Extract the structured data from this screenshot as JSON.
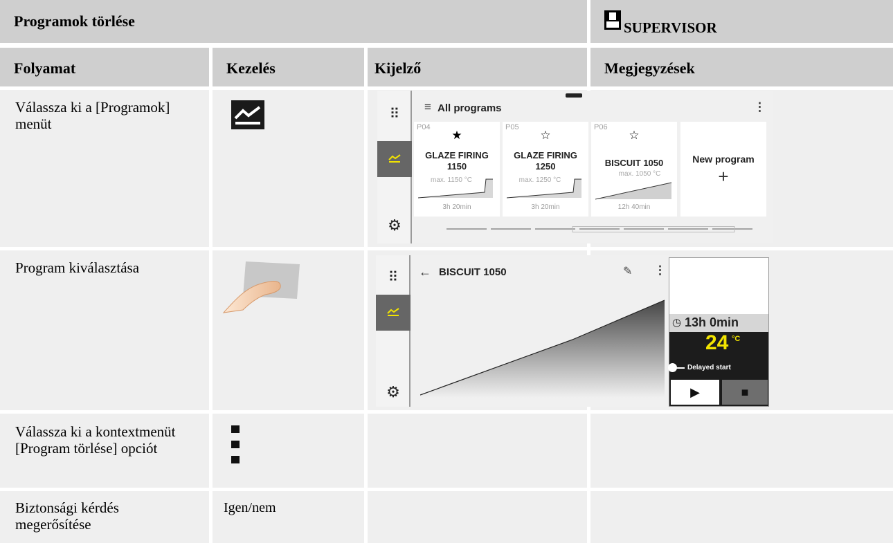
{
  "header": {
    "title": "Programok törlése",
    "role": "SUPERVISOR"
  },
  "columns": [
    "Folyamat",
    "Kezelés",
    "Kijelző",
    "Megjegyzések"
  ],
  "rows": [
    {
      "process": "Válassza ki a [Programok] menüt",
      "operation": ""
    },
    {
      "process": "Program kiválasztása",
      "operation": ""
    },
    {
      "process": "Válassza ki a kontextmenüt [Program törlése] opciót",
      "operation": ""
    },
    {
      "process": "Biztonsági kérdés megerősítése",
      "operation": "Igen/nem"
    }
  ],
  "screen1": {
    "title": "All programs",
    "list_icon": "≡",
    "more_icon": "⋮",
    "programs": [
      {
        "no": "P04",
        "star": "★",
        "name": "GLAZE FIRING 1150",
        "max": "max. 1150 °C",
        "time": "3h 20min"
      },
      {
        "no": "P05",
        "star": "☆",
        "name": "GLAZE FIRING 1250",
        "max": "max. 1250 °C",
        "time": "3h 20min"
      },
      {
        "no": "P06",
        "star": "☆",
        "name": "BISCUIT 1050",
        "max": "max. 1050 °C",
        "time": "12h 40min"
      }
    ],
    "new_program": "New program",
    "plus": "+"
  },
  "screen2": {
    "back": "←",
    "title": "BISCUIT 1050",
    "edit_icon": "✎",
    "more_icon": "⋮",
    "duration": "13h 0min",
    "temperature": "24",
    "unit": "°C",
    "delayed": "Delayed start",
    "play": "▶",
    "stop": "■"
  },
  "colors": {
    "header_bg": "#cfcfcf",
    "row_bg": "#efefef",
    "accent_yellow": "#f2e400",
    "rail_active": "#666666",
    "status_dark": "#1c1c1c"
  }
}
